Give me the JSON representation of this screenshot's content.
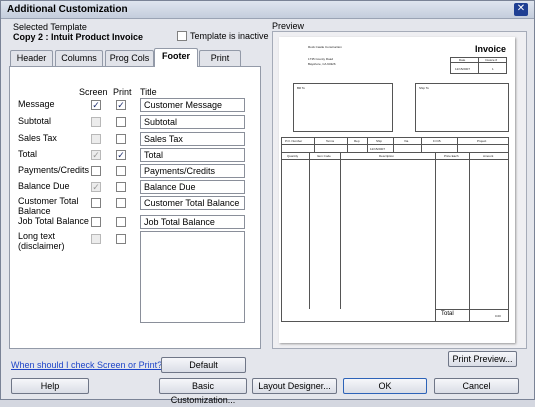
{
  "window": {
    "title": "Additional Customization"
  },
  "template": {
    "section_label": "Selected Template",
    "name": "Copy 2 : Intuit Product Invoice",
    "inactive_label": "Template is inactive",
    "inactive_checked": false
  },
  "tabs": [
    {
      "label": "Header"
    },
    {
      "label": "Columns"
    },
    {
      "label": "Prog Cols"
    },
    {
      "label": "Footer",
      "active": true
    },
    {
      "label": "Print"
    }
  ],
  "footer": {
    "col_screen": "Screen",
    "col_print": "Print",
    "col_title": "Title",
    "rows": [
      {
        "label": "Message",
        "screen": true,
        "print": true,
        "screen_enabled": true,
        "title": "Customer Message"
      },
      {
        "label": "Subtotal",
        "screen": false,
        "print": false,
        "screen_enabled": false,
        "title": "Subtotal"
      },
      {
        "label": "Sales Tax",
        "screen": false,
        "print": false,
        "screen_enabled": false,
        "title": "Sales Tax"
      },
      {
        "label": "Total",
        "screen": true,
        "print": true,
        "screen_enabled": false,
        "title": "Total"
      },
      {
        "label": "Payments/Credits",
        "screen": false,
        "print": false,
        "screen_enabled": true,
        "title": "Payments/Credits"
      },
      {
        "label": "Balance Due",
        "screen": true,
        "print": false,
        "screen_enabled": false,
        "title": "Balance Due"
      },
      {
        "label": "Customer Total Balance",
        "screen": false,
        "print": false,
        "screen_enabled": true,
        "title": "Customer Total Balance"
      },
      {
        "label": "Job Total Balance",
        "screen": false,
        "print": false,
        "screen_enabled": true,
        "title": "Job Total Balance"
      },
      {
        "label": "Long text (disclaimer)",
        "screen": false,
        "print": false,
        "screen_enabled": false,
        "title": ""
      }
    ]
  },
  "help_link": "When should I check Screen or Print?",
  "buttons": {
    "default": "Default",
    "print_preview": "Print Preview...",
    "help": "Help",
    "basic": "Basic Customization...",
    "layout": "Layout Designer...",
    "ok": "OK",
    "cancel": "Cancel"
  },
  "preview": {
    "label": "Preview",
    "company_name": "Rock Castle Construction",
    "company_address1": "1735 County Road",
    "company_address2": "Bayshore, CA 94326",
    "doc_title": "Invoice",
    "date_header": "Date",
    "invoice_no_header": "Invoice #",
    "date_value": "12/15/2007",
    "invoice_no_value": "1",
    "bill_to": "Bill To",
    "ship_to": "Ship To",
    "header_cols": [
      "P.O. Number",
      "Terms",
      "Rep",
      "Ship",
      "Via",
      "F.O.B.",
      "Project"
    ],
    "ship_date": "12/15/2007",
    "item_cols": [
      "Quantity",
      "Item Code",
      "Description",
      "Price Each",
      "Amount"
    ],
    "total_label": "Total",
    "total_value": "0.00"
  },
  "colors": {
    "window_bg": "#e4e6ec",
    "close_button": "#1f3f93",
    "link": "#1e45c8",
    "check": "#1c2c6c"
  }
}
